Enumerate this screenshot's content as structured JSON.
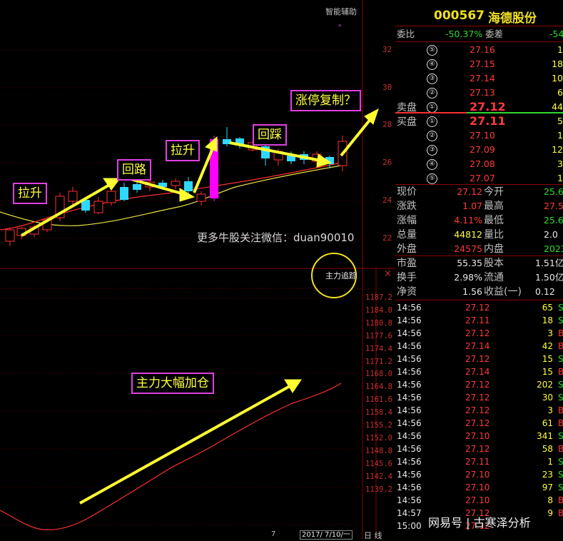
{
  "stock": {
    "code": "000567",
    "name": "海德股份"
  },
  "upper_chart": {
    "indicator_label": "智能辅助",
    "watermark": "更多牛股关注微信：duan90010",
    "y_ticks": [
      "32",
      "30",
      "28",
      "26",
      "24",
      "22"
    ]
  },
  "lower_chart": {
    "indicator_label": "主力追踪",
    "close_symbol": "×",
    "y_ticks": [
      "1187.2",
      "1184.0",
      "1180.8",
      "1177.6",
      "1174.4",
      "1171.2",
      "1168.0",
      "1164.8",
      "1161.6",
      "1158.4",
      "1155.2",
      "1152.0",
      "1148.8",
      "1145.6",
      "1142.4",
      "1139.2"
    ],
    "bottom_partial": "7",
    "date_partial": "2017/ 7/10/一",
    "tab_partial": "日 线"
  },
  "annotations": {
    "pull_up_1": "拉升",
    "pullback_1": "回路",
    "pull_up_2": "拉升",
    "pullback_2": "回踩",
    "limit_up": "涨停复制？",
    "main_force": "主力大幅加仓"
  },
  "order_book": {
    "wei_bi_label": "委比",
    "wei_bi_value": "-50.37%",
    "wei_cha_label": "委差",
    "wei_cha_value": "-54",
    "sell_label": "卖盘",
    "buy_label": "买盘",
    "sells": [
      {
        "level": "⑤",
        "price": "27.16",
        "vol": "1"
      },
      {
        "level": "④",
        "price": "27.15",
        "vol": "18"
      },
      {
        "level": "③",
        "price": "27.14",
        "vol": "10"
      },
      {
        "level": "②",
        "price": "27.13",
        "vol": "6"
      },
      {
        "level": "①",
        "price": "27.12",
        "vol": "44"
      }
    ],
    "buys": [
      {
        "level": "①",
        "price": "27.11",
        "vol": "5"
      },
      {
        "level": "②",
        "price": "27.10",
        "vol": "1"
      },
      {
        "level": "③",
        "price": "27.09",
        "vol": "12"
      },
      {
        "level": "④",
        "price": "27.08",
        "vol": "3"
      },
      {
        "level": "⑤",
        "price": "27.07",
        "vol": "1"
      }
    ]
  },
  "quote": [
    {
      "l1": "现价",
      "v1": "27.12",
      "l2": "今开",
      "v2": "25.6"
    },
    {
      "l1": "涨跌",
      "v1": "1.07",
      "l2": "最高",
      "v2": "27.5"
    },
    {
      "l1": "涨幅",
      "v1": "4.11%",
      "l2": "最低",
      "v2": "25.6"
    },
    {
      "l1": "总量",
      "v1": "44812",
      "l2": "量比",
      "v2": "2.0"
    },
    {
      "l1": "外盘",
      "v1": "24575",
      "l2": "内盘",
      "v2": "2023"
    }
  ],
  "fundamentals": [
    {
      "l1": "市盈",
      "v1": "55.35",
      "l2": "股本",
      "v2": "1.51亿"
    },
    {
      "l1": "换手",
      "v1": "2.98%",
      "l2": "流通",
      "v2": "1.50亿"
    },
    {
      "l1": "净资",
      "v1": "1.56",
      "l2": "收益(一)",
      "v2": "0.12"
    }
  ],
  "ticks": [
    {
      "time": "14:56",
      "price": "27.12",
      "vol": "65",
      "flag": "S"
    },
    {
      "time": "14:56",
      "price": "27.11",
      "vol": "18",
      "flag": "S"
    },
    {
      "time": "14:56",
      "price": "27.12",
      "vol": "3",
      "flag": "B"
    },
    {
      "time": "14:56",
      "price": "27.14",
      "vol": "42",
      "flag": "B"
    },
    {
      "time": "14:56",
      "price": "27.12",
      "vol": "15",
      "flag": "S"
    },
    {
      "time": "14:56",
      "price": "27.14",
      "vol": "15",
      "flag": "B"
    },
    {
      "time": "14:56",
      "price": "27.12",
      "vol": "202",
      "flag": "S"
    },
    {
      "time": "14:56",
      "price": "27.12",
      "vol": "30",
      "flag": "S"
    },
    {
      "time": "14:56",
      "price": "27.12",
      "vol": "3",
      "flag": "B"
    },
    {
      "time": "14:56",
      "price": "27.12",
      "vol": "61",
      "flag": "B"
    },
    {
      "time": "14:56",
      "price": "27.10",
      "vol": "341",
      "flag": "S"
    },
    {
      "time": "14:56",
      "price": "27.12",
      "vol": "58",
      "flag": "B"
    },
    {
      "time": "14:56",
      "price": "27.11",
      "vol": "1",
      "flag": "S"
    },
    {
      "time": "14:56",
      "price": "27.10",
      "vol": "23",
      "flag": "S"
    },
    {
      "time": "14:56",
      "price": "27.10",
      "vol": "97",
      "flag": "S"
    },
    {
      "time": "14:56",
      "price": "27.10",
      "vol": "8",
      "flag": "B"
    },
    {
      "time": "14:57",
      "price": "27.12",
      "vol": "9",
      "flag": "B"
    },
    {
      "time": "15:00",
      "price": "27.12",
      "vol": "",
      "flag": ""
    }
  ],
  "footer_watermark": "网易号 | 古寒泽分析",
  "colors": {
    "up": "#ff3a3a",
    "down": "#30d8ff",
    "grid": "#8b0000",
    "annotation_border": "#e040e0",
    "annotation_text": "#ffff40"
  }
}
